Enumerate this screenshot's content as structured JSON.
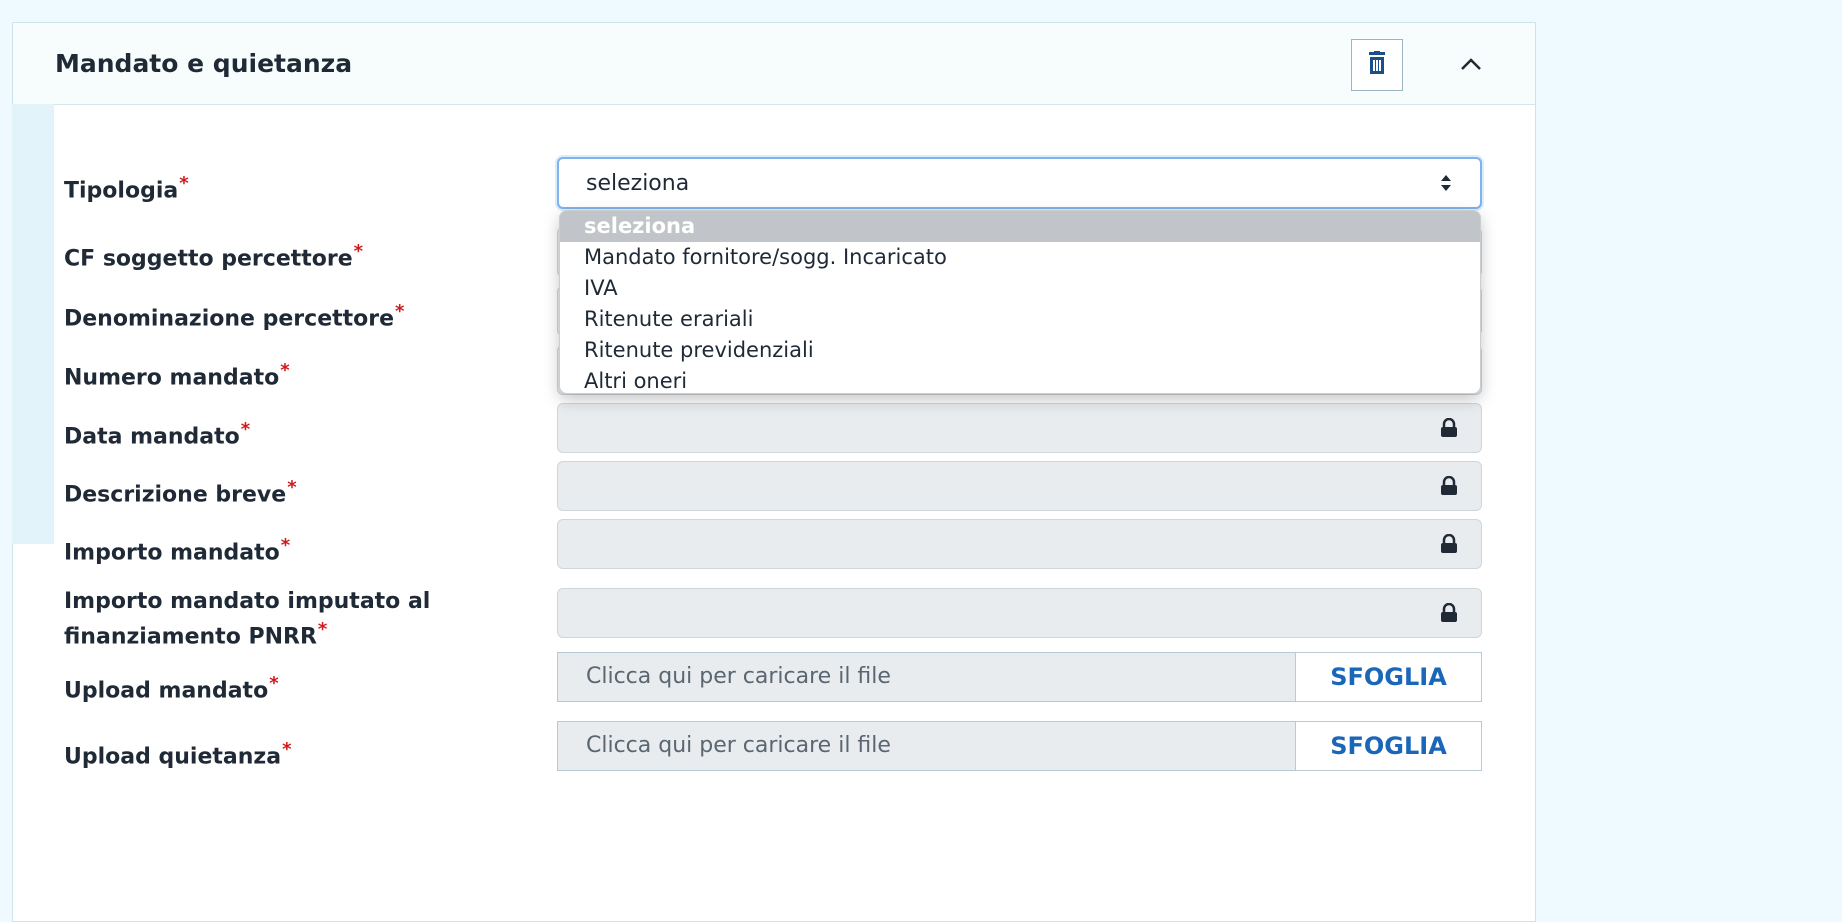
{
  "panel": {
    "title": "Mandato e quietanza",
    "delete_icon": "trash-icon",
    "collapse_icon": "chevron-up-icon"
  },
  "form": {
    "required_mark": "*",
    "labels": {
      "tipologia": "Tipologia",
      "cf_soggetto": "CF soggetto percettore",
      "denominazione": "Denominazione percettore",
      "numero_mandato": "Numero mandato",
      "data_mandato": "Data mandato",
      "descrizione_breve": "Descrizione breve",
      "importo_mandato": "Importo mandato",
      "importo_pnrr_line1": "Importo mandato imputato al",
      "importo_pnrr_line2": "finanziamento PNRR",
      "upload_mandato": "Upload mandato",
      "upload_quietanza": "Upload quietanza"
    },
    "tipologia_select": {
      "value": "seleziona",
      "options": [
        "seleziona",
        "Mandato fornitore/sogg. Incaricato",
        "IVA",
        "Ritenute erariali",
        "Ritenute previdenziali",
        "Altri oneri"
      ]
    },
    "upload": {
      "placeholder": "Clicca qui per caricare il file",
      "browse_label": "SFOGLIA"
    }
  },
  "colors": {
    "accent": "#1a66b8",
    "required": "#d11919",
    "locked_field": "#e8ecef"
  }
}
